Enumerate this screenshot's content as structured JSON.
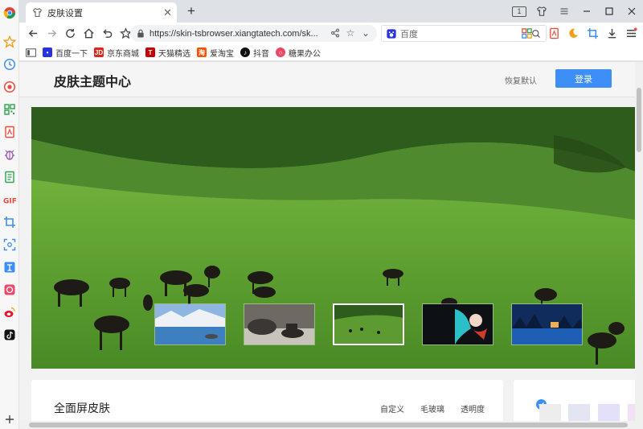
{
  "tab": {
    "title": "皮肤设置"
  },
  "window": {
    "tab_count": "1"
  },
  "address": {
    "url": "https://skin-tsbrowser.xiangtatech.com/sk..."
  },
  "search": {
    "placeholder": "百度"
  },
  "bookmarks": [
    {
      "label": "百度一下",
      "icon": "paw-icon",
      "color": "#2932e1"
    },
    {
      "label": "京东商城",
      "icon": "jd-icon",
      "color": "#e1251b"
    },
    {
      "label": "天猫精选",
      "icon": "tmall-icon",
      "color": "#c40000"
    },
    {
      "label": "爱淘宝",
      "icon": "taobao-icon",
      "color": "#ff5000"
    },
    {
      "label": "抖音",
      "icon": "douyin-icon",
      "color": "#111111"
    },
    {
      "label": "糖果办公",
      "icon": "candy-icon",
      "color": "#ef4565"
    }
  ],
  "page": {
    "title": "皮肤主题中心",
    "restore_label": "恢复默认",
    "login_label": "登录"
  },
  "skins": [
    {
      "name": "lake-mountain"
    },
    {
      "name": "cat-teacup"
    },
    {
      "name": "grassland",
      "selected": true
    },
    {
      "name": "anime-girl"
    },
    {
      "name": "night-lake"
    }
  ],
  "panel": {
    "title": "全面屏皮肤",
    "options": [
      "自定义",
      "毛玻璃",
      "透明度"
    ]
  },
  "colors": {
    "accent": "#3d8ff7",
    "sidebar_icon": "#e94b3c"
  }
}
